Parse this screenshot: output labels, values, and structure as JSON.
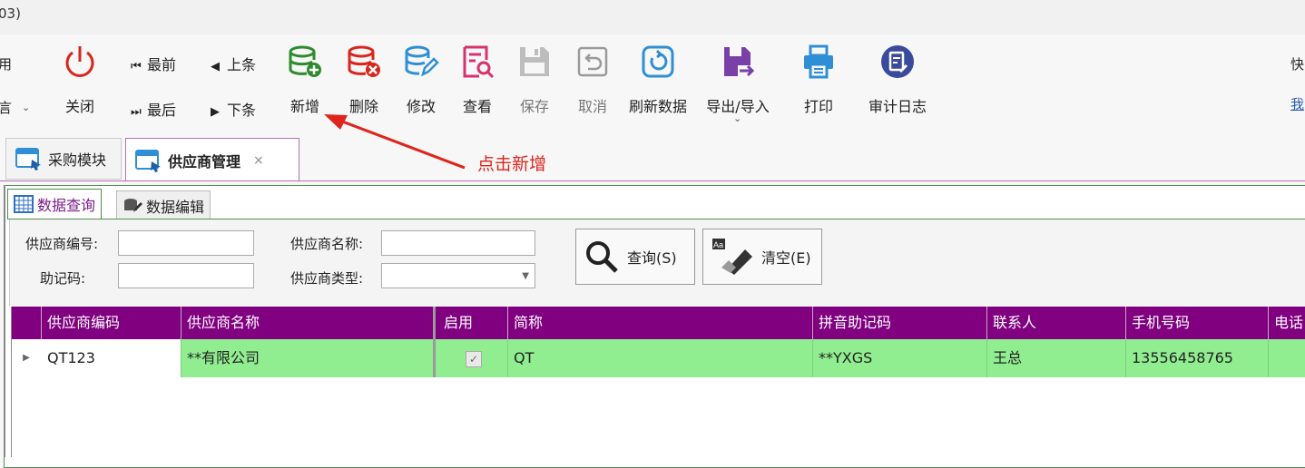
{
  "window": {
    "title_fragment": "03)"
  },
  "ribbon": {
    "left_edge_top": "用",
    "left_edge_bottom": "言",
    "right_edge_top": "快",
    "right_edge_bottom": "我",
    "buttons": {
      "close": "关闭",
      "add": "新增",
      "delete": "删除",
      "edit": "修改",
      "view": "查看",
      "save": "保存",
      "cancel": "取消",
      "refresh": "刷新数据",
      "export_import": "导出/导入",
      "print": "打印",
      "audit_log": "审计日志"
    },
    "nav": {
      "first": "最前",
      "prev": "上条",
      "last": "最后",
      "next": "下条"
    }
  },
  "tabs": {
    "tab1": "采购模块",
    "tab2": "供应商管理",
    "close_glyph": "×"
  },
  "annotation": "点击新增",
  "subtabs": {
    "query": "数据查询",
    "edit": "数据编辑"
  },
  "form": {
    "code_label": "供应商编号:",
    "name_label": "供应商名称:",
    "mnemonic_label": "助记码:",
    "type_label": "供应商类型:",
    "code_value": "",
    "name_value": "",
    "mnemonic_value": "",
    "type_value": "",
    "query_button": "查询(S)",
    "clear_button": "清空(E)"
  },
  "grid": {
    "columns": [
      "供应商编码",
      "供应商名称",
      "启用",
      "简称",
      "拼音助记码",
      "联系人",
      "手机号码",
      "电话"
    ],
    "rows": [
      {
        "code": "QT123",
        "name": "**有限公司",
        "enabled": true,
        "short": "QT",
        "pinyin": "**YXGS",
        "contact": "王总",
        "mobile": "13556458765",
        "phone": ""
      }
    ]
  },
  "colors": {
    "header_bg": "#800080",
    "row_bg": "#90ee90",
    "annotation": "#e0241b",
    "accent_tab": "#b56fb8"
  }
}
